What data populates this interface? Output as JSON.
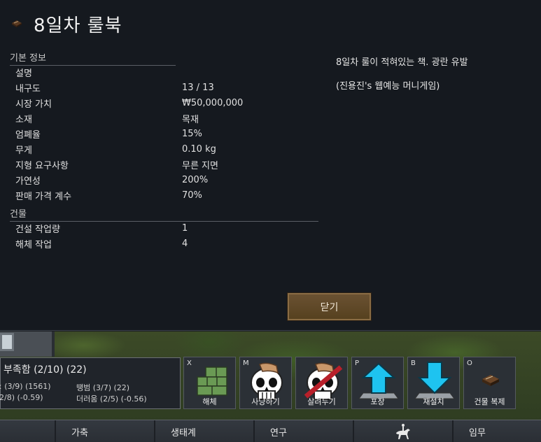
{
  "dialog": {
    "title": "8일차 룰북",
    "basic_info_header": "기본 정보",
    "stats": [
      {
        "label": "설명",
        "value": ""
      },
      {
        "label": "내구도",
        "value": "13 / 13"
      },
      {
        "label": "시장 가치",
        "value": "₩50,000,000"
      },
      {
        "label": "소재",
        "value": "목재"
      },
      {
        "label": "엄폐율",
        "value": "15%"
      },
      {
        "label": "무게",
        "value": "0.10 kg"
      },
      {
        "label": "지형 요구사항",
        "value": "무른 지면"
      },
      {
        "label": "가연성",
        "value": "200%"
      },
      {
        "label": "판매 가격 계수",
        "value": "70%"
      }
    ],
    "building_header": "건물",
    "building_stats": [
      {
        "label": "건설 작업량",
        "value": "1"
      },
      {
        "label": "해체 작업",
        "value": "4"
      }
    ],
    "description_lines": [
      "8일차 룰이 적혀있는 책. 광란 유발",
      "(진용진's 웹예능 머니게임)"
    ],
    "close_label": "닫기"
  },
  "colonist": {
    "name": "부족함 (2/10) (22)",
    "needs": [
      "ː (3/9) (1561)",
      "땡범 (3/7) (22)",
      "2/8) (-0.59)",
      "더러움 (2/5) (-0.56)"
    ]
  },
  "orders": [
    {
      "key": "X",
      "label": "해체",
      "icon": "deconstruct-icon"
    },
    {
      "key": "M",
      "label": "사냥하기",
      "icon": "hunt-skull-icon"
    },
    {
      "key": "",
      "label": "살려두기",
      "icon": "spare-skull-icon"
    },
    {
      "key": "P",
      "label": "포장",
      "icon": "pack-arrow-up-icon"
    },
    {
      "key": "B",
      "label": "재설치",
      "icon": "reinstall-arrow-down-icon"
    },
    {
      "key": "O",
      "label": "건물 복제",
      "icon": "copy-building-icon"
    }
  ],
  "main_tabs": [
    {
      "label": ""
    },
    {
      "label": "가축"
    },
    {
      "label": "생태계"
    },
    {
      "label": "연구"
    },
    {
      "label": "",
      "icon": "horse-rider-icon"
    },
    {
      "label": "임무"
    }
  ],
  "colors": {
    "dialog_bg": "#15191f",
    "close_button": "#6a5132",
    "order_arrow": "#1ec3f0",
    "skull": "#ffffff",
    "forbid_slash": "#b8202a"
  }
}
